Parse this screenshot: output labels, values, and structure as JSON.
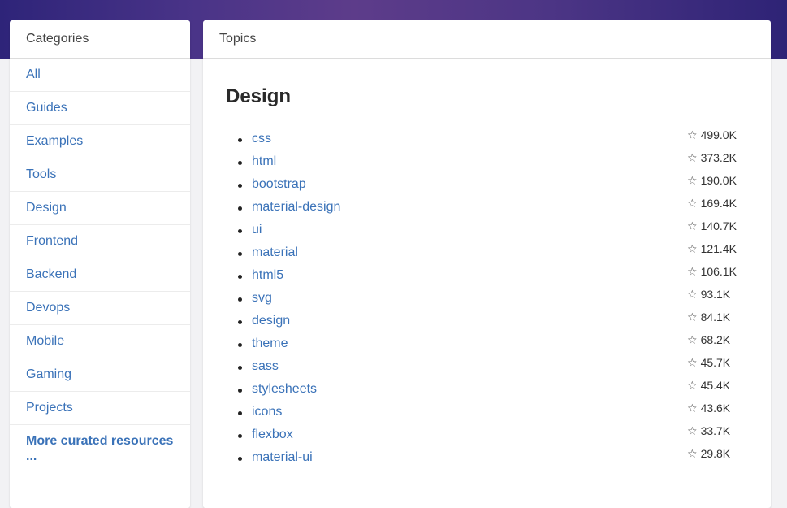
{
  "sidebar": {
    "title": "Categories",
    "items": [
      {
        "label": "All"
      },
      {
        "label": "Guides"
      },
      {
        "label": "Examples"
      },
      {
        "label": "Tools"
      },
      {
        "label": "Design"
      },
      {
        "label": "Frontend"
      },
      {
        "label": "Backend"
      },
      {
        "label": "Devops"
      },
      {
        "label": "Mobile"
      },
      {
        "label": "Gaming"
      },
      {
        "label": "Projects"
      }
    ],
    "more_label": "More curated resources",
    "more_ellipsis": "..."
  },
  "main": {
    "title": "Topics",
    "section_title": "Design",
    "topics": [
      {
        "name": "css",
        "stars": "499.0K"
      },
      {
        "name": "html",
        "stars": "373.2K"
      },
      {
        "name": "bootstrap",
        "stars": "190.0K"
      },
      {
        "name": "material-design",
        "stars": "169.4K"
      },
      {
        "name": "ui",
        "stars": "140.7K"
      },
      {
        "name": "material",
        "stars": "121.4K"
      },
      {
        "name": "html5",
        "stars": "106.1K"
      },
      {
        "name": "svg",
        "stars": "93.1K"
      },
      {
        "name": "design",
        "stars": "84.1K"
      },
      {
        "name": "theme",
        "stars": "68.2K"
      },
      {
        "name": "sass",
        "stars": "45.7K"
      },
      {
        "name": "stylesheets",
        "stars": "45.4K"
      },
      {
        "name": "icons",
        "stars": "43.6K"
      },
      {
        "name": "flexbox",
        "stars": "33.7K"
      },
      {
        "name": "material-ui",
        "stars": "29.8K"
      }
    ]
  },
  "icons": {
    "star": "star-outline-icon"
  },
  "colors": {
    "link": "#3a72b8",
    "banner_start": "#2e2479",
    "banner_mid": "#5d3c8a"
  }
}
